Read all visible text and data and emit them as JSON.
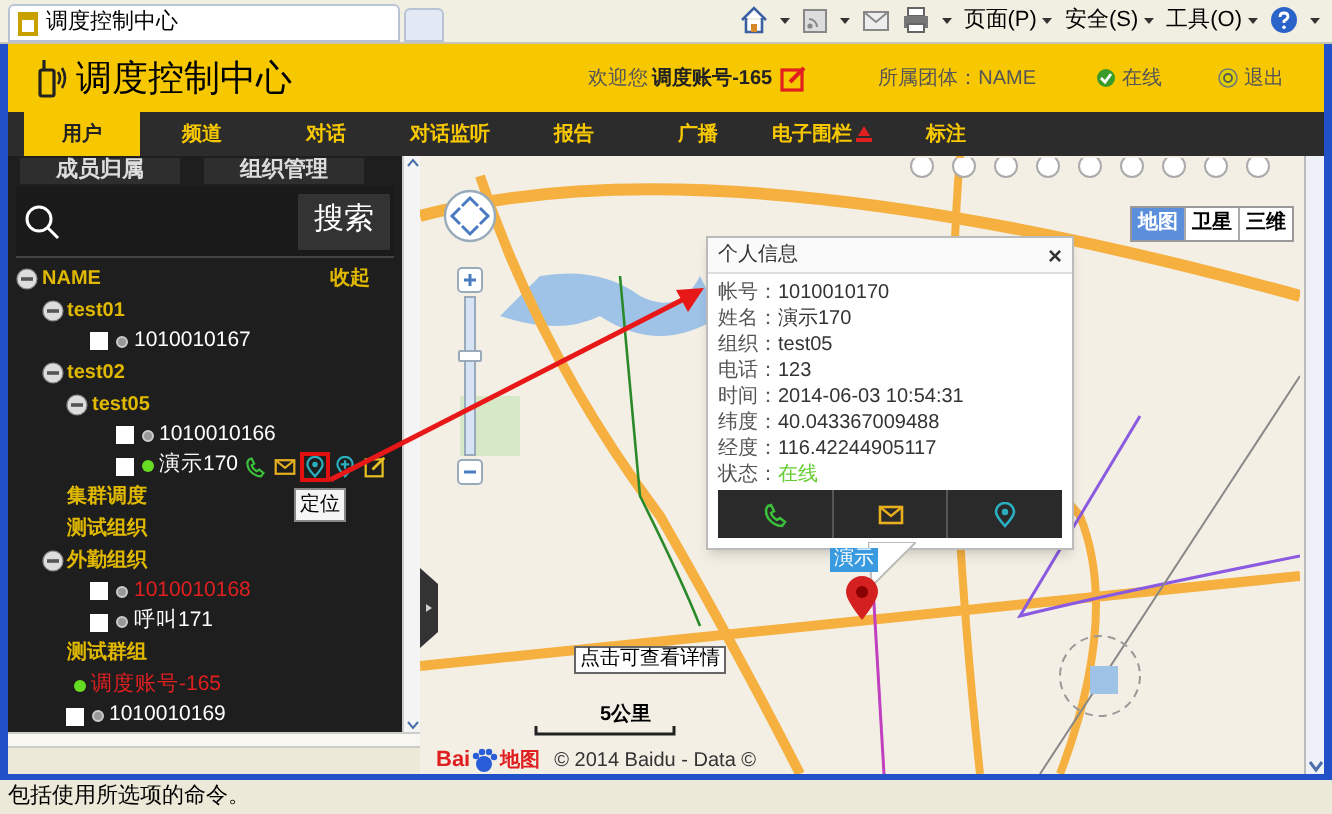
{
  "browser": {
    "tab_title": "调度控制中心",
    "menus": [
      "页面(P)",
      "安全(S)",
      "工具(O)"
    ]
  },
  "header": {
    "title": "调度控制中心",
    "welcome": "欢迎您",
    "account": "调度账号-165",
    "team": "所属团体：NAME",
    "status": "在线",
    "logout": "退出"
  },
  "nav": [
    {
      "label": "用户",
      "selected": true,
      "badge": false
    },
    {
      "label": "频道",
      "selected": false,
      "badge": false
    },
    {
      "label": "对话",
      "selected": false,
      "badge": false
    },
    {
      "label": "对话监听",
      "selected": false,
      "badge": false
    },
    {
      "label": "报告",
      "selected": false,
      "badge": false
    },
    {
      "label": "广播",
      "selected": false,
      "badge": false
    },
    {
      "label": "电子围栏",
      "selected": false,
      "badge": true
    },
    {
      "label": "标注",
      "selected": false,
      "badge": false
    }
  ],
  "sidebar": {
    "buttons": [
      "成员归属",
      "组织管理"
    ],
    "search_button": "搜索",
    "collapse": "收起",
    "tree": [
      {
        "kind": "group",
        "label": "NAME",
        "expanded": true,
        "children": [
          {
            "kind": "group",
            "label": "test01",
            "expanded": true,
            "children": [
              {
                "kind": "member",
                "label": "1010010167",
                "online": false,
                "checked": false,
                "alert": false
              }
            ]
          },
          {
            "kind": "group",
            "label": "test02",
            "expanded": true,
            "children": [
              {
                "kind": "group",
                "label": "test05",
                "expanded": true,
                "children": [
                  {
                    "kind": "member",
                    "label": "1010010166",
                    "online": false,
                    "checked": false,
                    "alert": false
                  },
                  {
                    "kind": "member",
                    "label": "演示170",
                    "online": true,
                    "checked": false,
                    "alert": false,
                    "actions": [
                      {
                        "kind": "call",
                        "selected": false
                      },
                      {
                        "kind": "message",
                        "selected": false
                      },
                      {
                        "kind": "locate",
                        "selected": true,
                        "tooltip": "定位"
                      },
                      {
                        "kind": "add",
                        "selected": false
                      },
                      {
                        "kind": "edit",
                        "selected": false
                      }
                    ]
                  }
                ]
              }
            ]
          },
          {
            "kind": "leaf_group",
            "label": "集群调度"
          },
          {
            "kind": "leaf_group",
            "label": "测试组织"
          },
          {
            "kind": "group",
            "label": "外勤组织",
            "expanded": true,
            "children": [
              {
                "kind": "member",
                "label": "1010010168",
                "online": false,
                "checked": false,
                "alert": true
              },
              {
                "kind": "member",
                "label": "呼叫171",
                "online": false,
                "checked": false,
                "alert": false
              }
            ]
          },
          {
            "kind": "leaf_group",
            "label": "测试群组"
          },
          {
            "kind": "account",
            "label": "调度账号-165",
            "online": true,
            "alert": true
          },
          {
            "kind": "member",
            "label": "1010010169",
            "online": false,
            "checked": false,
            "alert": false
          }
        ]
      }
    ]
  },
  "map": {
    "types": [
      {
        "label": "地图",
        "selected": true
      },
      {
        "label": "卫星",
        "selected": false
      },
      {
        "label": "三维",
        "selected": false
      }
    ],
    "popup": {
      "title": "个人信息",
      "close": "×",
      "rows": [
        {
          "kind": "text",
          "label": "帐号：",
          "value": "1010010170"
        },
        {
          "kind": "text",
          "label": "姓名：",
          "value": "演示170"
        },
        {
          "kind": "text",
          "label": "组织：",
          "value": "test05"
        },
        {
          "kind": "text",
          "label": "电话：",
          "value": "123"
        },
        {
          "kind": "text",
          "label": "时间：",
          "value": "2014-06-03 10:54:31"
        },
        {
          "kind": "text",
          "label": "纬度：",
          "value": "40.043367009488"
        },
        {
          "kind": "text",
          "label": "经度：",
          "value": "116.42244905117"
        },
        {
          "kind": "status",
          "label": "状态：",
          "value": "在线"
        }
      ],
      "actions": [
        {
          "kind": "call"
        },
        {
          "kind": "message"
        },
        {
          "kind": "locate"
        }
      ]
    },
    "zoom": {
      "level": 0.65
    },
    "marker_label": "演示",
    "hint": "点击可查看详情",
    "scale": "5公里",
    "logo_left": "Bai",
    "logo_right": "地图",
    "copyright": "© 2014 Baidu - Data ©"
  },
  "status_bar": "包括使用所选项的命令。"
}
